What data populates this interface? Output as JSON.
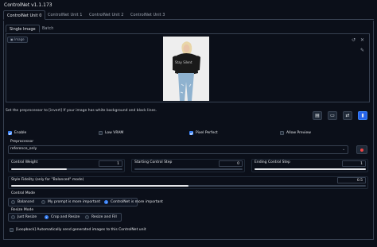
{
  "header": {
    "title": "ControlNet v1.1.173"
  },
  "tabs": [
    "ControlNet Unit 0",
    "ControlNet Unit 1",
    "ControlNet Unit 2",
    "ControlNet Unit 3"
  ],
  "subtabs": [
    "Single Image",
    "Batch"
  ],
  "image_panel": {
    "label": "Image",
    "label_icon": "image-icon",
    "photo_caption": "Stay Silent"
  },
  "hint": "Set the preprocessor to [invert] If your image has white background and black lines.",
  "tool_buttons": [
    "document-icon",
    "camera-icon",
    "swap-icon",
    "pin-icon"
  ],
  "options": {
    "enable": {
      "label": "Enable",
      "checked": true
    },
    "low_vram": {
      "label": "Low VRAM",
      "checked": false
    },
    "pixel_perfect": {
      "label": "Pixel Perfect",
      "checked": true
    },
    "allow_preview": {
      "label": "Allow Preview",
      "checked": false
    }
  },
  "preprocessor": {
    "label": "Preprocessor",
    "value": "reference_only",
    "accent": "#ef4444"
  },
  "sliders": {
    "control_weight": {
      "label": "Control Weight",
      "value": "1",
      "level": 0.5
    },
    "start_step": {
      "label": "Starting Control Step",
      "value": "0",
      "level": 0
    },
    "end_step": {
      "label": "Ending Control Step",
      "value": "1",
      "level": 1
    },
    "style_fidelity": {
      "label": "Style Fidelity (only for \"Balanced\" mode)",
      "value": "0.5",
      "level": 0.5
    }
  },
  "control_mode": {
    "label": "Control Mode",
    "options": [
      "Balanced",
      "My prompt is more important",
      "ControlNet is more important"
    ],
    "selected": 2
  },
  "resize_mode": {
    "label": "Resize Mode",
    "options": [
      "Just Resize",
      "Crop and Resize",
      "Resize and Fill"
    ],
    "selected": 1
  },
  "loopback": {
    "label": "[Loopback] Automatically send generated images to this ControlNet unit",
    "checked": false
  },
  "colors": {
    "background": "#0b0f19",
    "accent": "#3b82f6",
    "border": "#374151"
  }
}
